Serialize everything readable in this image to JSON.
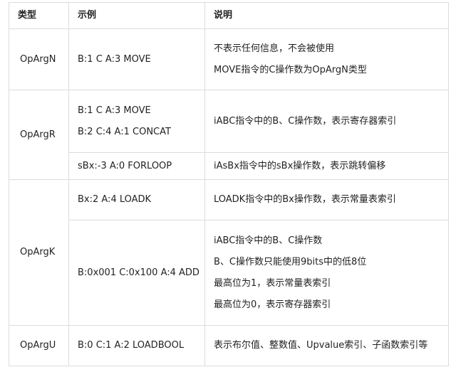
{
  "headers": {
    "type": "类型",
    "example": "示例",
    "description": "说明"
  },
  "rows": {
    "opargn": {
      "type": "OpArgN",
      "example": [
        "B:1 C A:3 MOVE"
      ],
      "description": [
        "不表示任何信息，不会被使用",
        "MOVE指令的C操作数为OpArgN类型"
      ]
    },
    "opargr": {
      "type": "OpArgR",
      "sub1": {
        "example": [
          "B:1 C A:3 MOVE",
          "B:2 C:4 A:1 CONCAT"
        ],
        "description": [
          "iABC指令中的B、C操作数，表示寄存器索引"
        ]
      },
      "sub2": {
        "example": [
          "sBx:-3 A:0 FORLOOP"
        ],
        "description": [
          "iAsBx指令中的sBx操作数，表示跳转偏移"
        ]
      }
    },
    "opargk": {
      "type": "OpArgK",
      "sub1": {
        "example": [
          "Bx:2 A:4 LOADK"
        ],
        "description": [
          "LOADK指令中的Bx操作数，表示常量表索引"
        ]
      },
      "sub2": {
        "example": [
          "B:0x001 C:0x100 A:4 ADD"
        ],
        "description": [
          "iABC指令中的B、C操作数",
          "B、C操作数只能使用9bits中的低8位",
          "最高位为1，表示常量表索引",
          "最高位为0，表示寄存器索引"
        ]
      }
    },
    "opargu": {
      "type": "OpArgU",
      "example": [
        "B:0 C:1 A:2 LOADBOOL"
      ],
      "description": [
        "表示布尔值、整数值、Upvalue索引、子函数索引等"
      ]
    }
  }
}
